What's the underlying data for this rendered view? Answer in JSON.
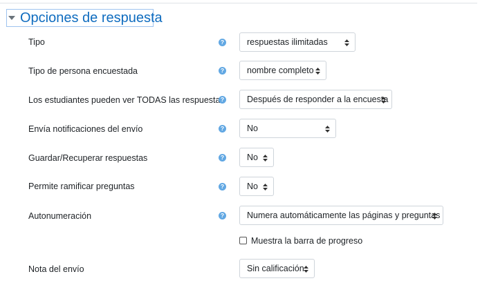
{
  "section": {
    "title": "Opciones de respuesta"
  },
  "fields": [
    {
      "label": "Tipo",
      "value": "respuestas ilimitadas"
    },
    {
      "label": "Tipo de persona encuestada",
      "value": "nombre completo"
    },
    {
      "label": "Los estudiantes pueden ver TODAS las respuestas",
      "value": "Después de responder a la encuesta"
    },
    {
      "label": "Envía notificaciones del envío",
      "value": "No"
    },
    {
      "label": "Guardar/Recuperar respuestas",
      "value": "No"
    },
    {
      "label": "Permite ramificar preguntas",
      "value": "No"
    },
    {
      "label": "Autonumeración",
      "value": "Numera automáticamente las páginas y preguntas"
    },
    {
      "label": "Nota del envío",
      "value": "Sin calificación"
    }
  ],
  "checkbox": {
    "label": "Muestra la barra de progreso",
    "checked": false
  },
  "help_icon_glyph": "?",
  "icons": {
    "help": "question-circle-icon",
    "select": "sort-arrows-icon",
    "section": "caret-down-icon"
  },
  "colors": {
    "accent": "#0f6cbf",
    "help": "#62a8e3",
    "border": "#ced4da"
  }
}
